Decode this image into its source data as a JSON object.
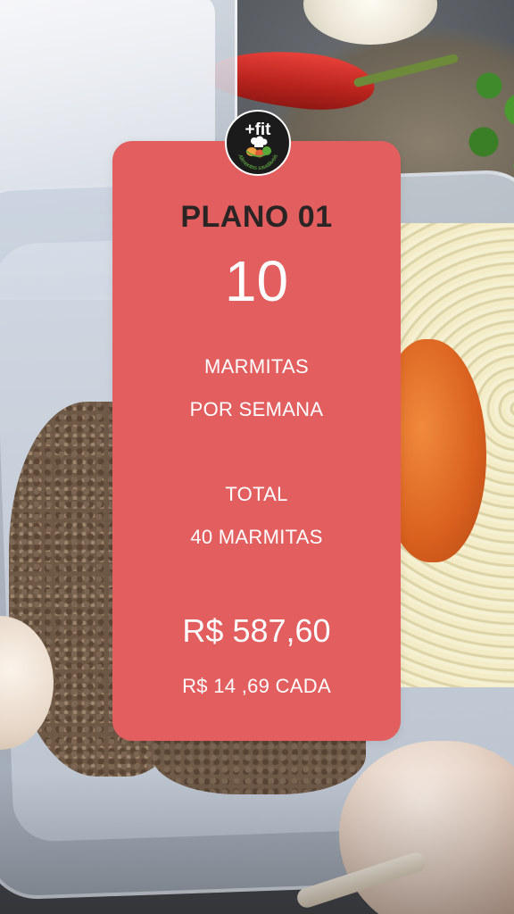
{
  "brand": {
    "name": "+fit",
    "tagline": "Alimentos saudáveis"
  },
  "card": {
    "plan_title": "PLANO 01",
    "meal_count": "10",
    "line1": "MARMITAS",
    "line2": "POR SEMANA",
    "line3": "TOTAL",
    "line4": "40 MARMITAS",
    "price": "R$ 587,60",
    "unit_price": "R$ 14 ,69 CADA"
  },
  "colors": {
    "card": "#e25e5f",
    "title_text": "#2b2424",
    "body_text": "#ffffff",
    "logo_bg": "#1b1b1b"
  }
}
